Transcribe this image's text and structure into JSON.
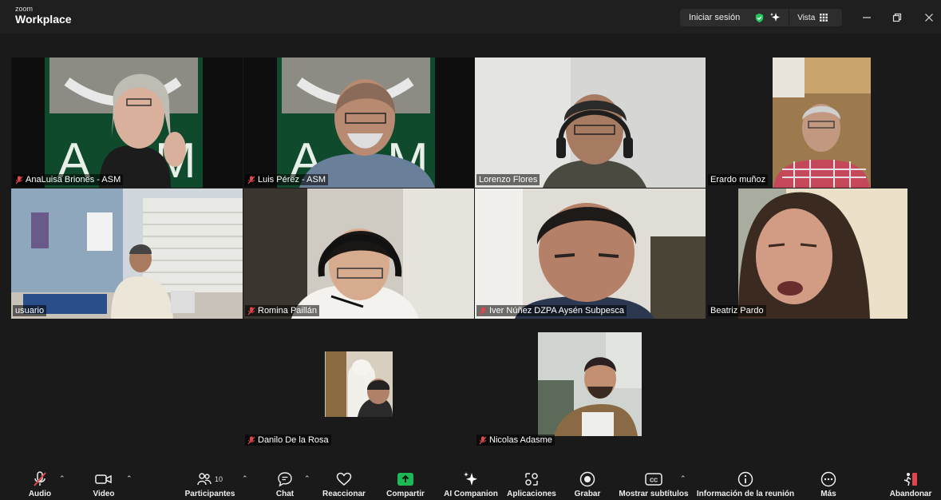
{
  "app": {
    "brand_small": "zoom",
    "brand_name": "Workplace"
  },
  "topbar": {
    "signin_label": "Iniciar sesión",
    "view_label": "Vista"
  },
  "participants": [
    {
      "name": "AnaLuisa Briones - ASM",
      "muted": true
    },
    {
      "name": "Luis Pérez - ASM",
      "muted": true
    },
    {
      "name": "Lorenzo Flores",
      "muted": false
    },
    {
      "name": "Erardo muñoz",
      "muted": false
    },
    {
      "name": "usuario",
      "muted": false
    },
    {
      "name": "Romina Paillán",
      "muted": true
    },
    {
      "name": "Iver Núñez DZPA Aysén Subpesca",
      "muted": true
    },
    {
      "name": "Beatriz Pardo",
      "muted": false,
      "active_speaker": true
    },
    {
      "name": "Danilo De la Rosa",
      "muted": true
    },
    {
      "name": "Nicolas Adasme",
      "muted": true
    }
  ],
  "toolbar": {
    "audio": "Audio",
    "video": "Video",
    "participants": "Participantes",
    "participants_count": "10",
    "chat": "Chat",
    "react": "Reaccionar",
    "share": "Compartir",
    "ai_companion": "AI Companion",
    "apps": "Aplicaciones",
    "record": "Grabar",
    "captions": "Mostrar subtítulos",
    "meeting_info": "Información de la reunión",
    "more": "Más",
    "leave": "Abandonar"
  },
  "colors": {
    "active_speaker": "#3ccf7a",
    "share_green": "#1db954",
    "leave_red": "#e0464b",
    "shield_green": "#22c55e"
  }
}
